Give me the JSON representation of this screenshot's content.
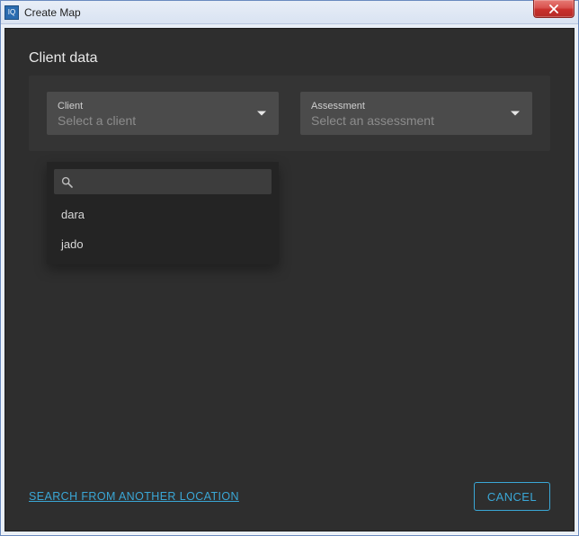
{
  "window": {
    "title": "Create Map",
    "icon_text": "IQ"
  },
  "section": {
    "heading": "Client data"
  },
  "client_select": {
    "label": "Client",
    "placeholder": "Select a client",
    "open": true,
    "search_value": "",
    "options": [
      "dara",
      "jado"
    ]
  },
  "assessment_select": {
    "label": "Assessment",
    "placeholder": "Select an assessment"
  },
  "footer": {
    "link_label": "SEARCH FROM ANOTHER LOCATION",
    "cancel_label": "CANCEL"
  },
  "colors": {
    "accent": "#3aa7d6",
    "panel": "#2e2e2e",
    "card": "#343434",
    "field": "#4b4b4b",
    "dropdown": "#242424"
  }
}
